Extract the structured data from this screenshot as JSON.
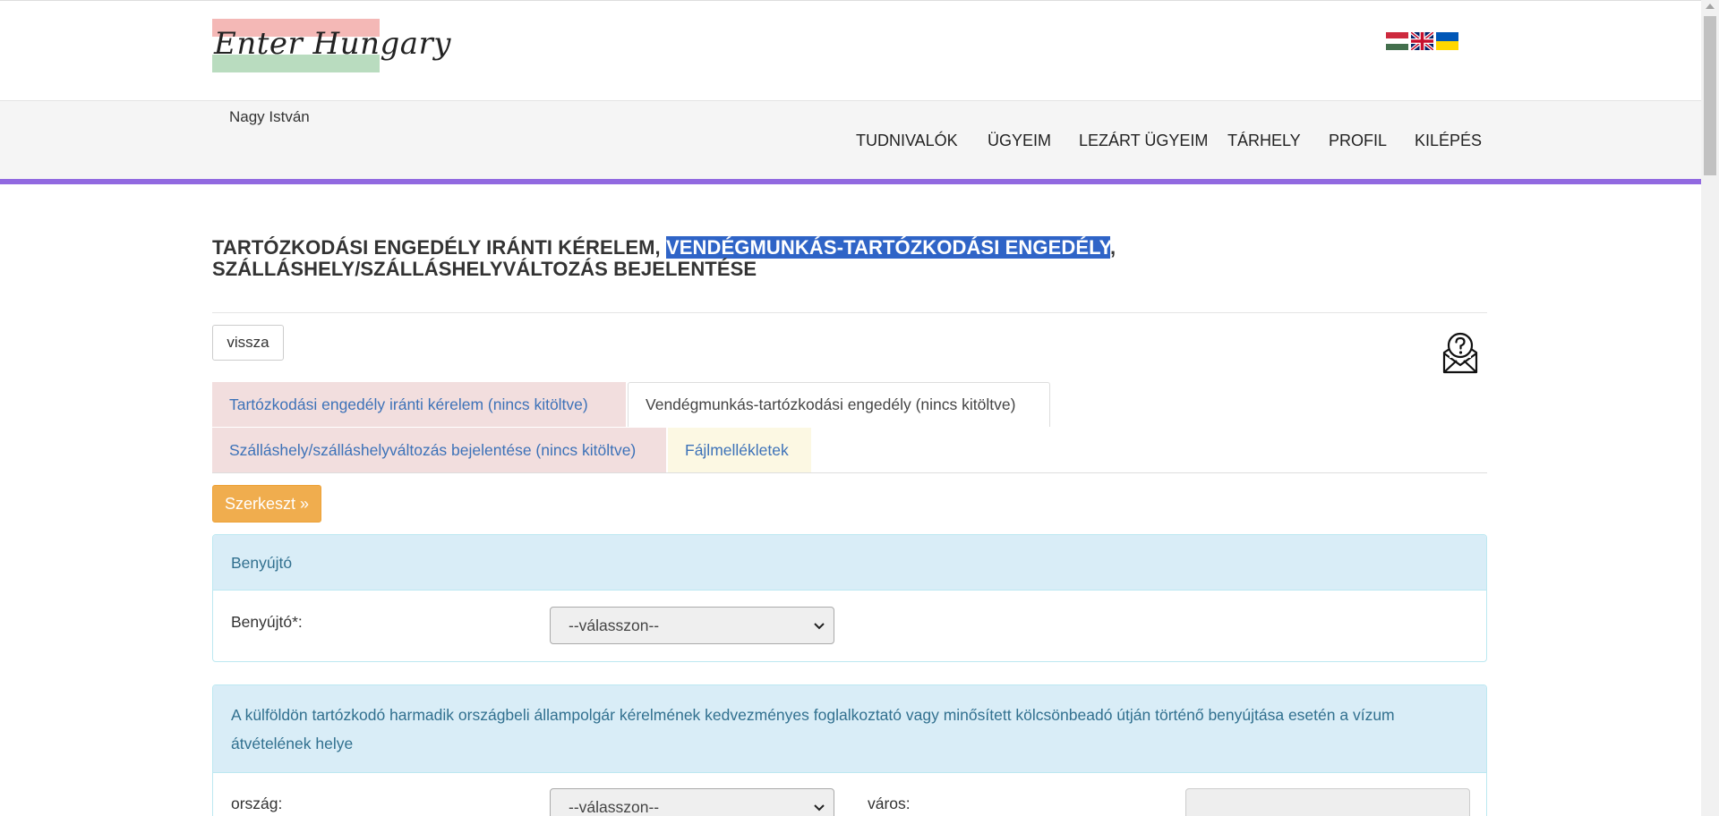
{
  "header": {
    "logo_text": "Enter Hungary",
    "languages": [
      {
        "name": "hungarian-flag-icon",
        "colors": [
          "#cd2a3e",
          "#ffffff",
          "#436f4d"
        ]
      },
      {
        "name": "uk-flag-icon",
        "colors": [
          "#012169",
          "#ffffff",
          "#c8102e"
        ]
      },
      {
        "name": "ukraine-flag-icon",
        "colors": [
          "#0057b7",
          "#ffd700"
        ]
      }
    ]
  },
  "nav": {
    "user_name": "Nagy István",
    "items": [
      "TUDNIVALÓK",
      "ÜGYEIM",
      "LEZÁRT ÜGYEIM",
      "TÁRHELY",
      "PROFIL",
      "KILÉPÉS"
    ],
    "accent_color": "#9169e0"
  },
  "page": {
    "title_part1": "TARTÓZKODÁSI ENGEDÉLY IRÁNTI KÉRELEM, ",
    "title_highlight": "VENDÉGMUNKÁS-TARTÓZKODÁSI ENGEDÉLY",
    "title_part2": ", SZÁLLÁSHELY/SZÁLLÁSHELYVÁLTOZÁS BEJELENTÉSE",
    "back_label": "vissza",
    "edit_label": "Szerkeszt »",
    "tabs": [
      {
        "label": "Tartózkodási engedély iránti kérelem (nincs kitöltve)"
      },
      {
        "label": "Vendégmunkás-tartózkodási engedély (nincs kitöltve)"
      },
      {
        "label": "Szálláshely/szálláshelyváltozás bejelentése (nincs kitöltve)"
      },
      {
        "label": "Fájlmellékletek"
      }
    ]
  },
  "panels": {
    "submitter": {
      "heading": "Benyújtó",
      "field_label": "Benyújtó*:",
      "select_value": "--válasszon--"
    },
    "visa_pickup": {
      "heading": "A külföldön tartózkodó harmadik országbeli állampolgár kérelmének kedvezményes foglalkoztató vagy minősített kölcsönbeadó útján történő benyújtása esetén a vízum átvételének helye",
      "country_label": "ország:",
      "country_value": "--válasszon--",
      "city_label": "város:"
    }
  }
}
